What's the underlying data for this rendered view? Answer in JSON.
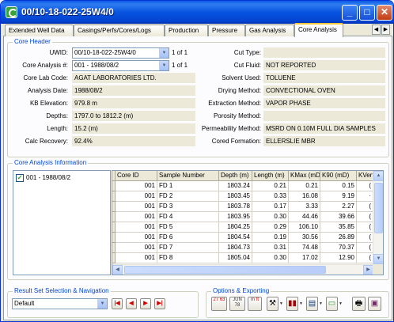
{
  "window": {
    "title": "00/10-18-022-25W4/0",
    "min": "_",
    "max": "□",
    "close": "✕"
  },
  "tabs": [
    {
      "label": "Extended Well Data"
    },
    {
      "label": "Casings/Perfs/Cores/Logs"
    },
    {
      "label": "Production"
    },
    {
      "label": "Pressure"
    },
    {
      "label": "Gas Analysis"
    },
    {
      "label": "Core Analysis",
      "active": true
    }
  ],
  "tab_scroll": {
    "left": "◀",
    "right": "▶"
  },
  "core_header": {
    "legend": "Core Header",
    "uwid_label": "UWID:",
    "uwid_value": "00/10-18-022-25W4/0",
    "uwid_count": "1 of 1",
    "analysis_label": "Core Analysis #:",
    "analysis_value": "001 - 1988/08/2",
    "analysis_count": "1 of 1",
    "lab_label": "Core Lab Code:",
    "lab_value": "AGAT LABORATORIES LTD.",
    "date_label": "Analysis Date:",
    "date_value": "1988/08/2",
    "kb_label": "KB Elevation:",
    "kb_value": "979.8 m",
    "depths_label": "Depths:",
    "depths_value": "1797.0 to 1812.2 (m)",
    "length_label": "Length:",
    "length_value": "15.2 (m)",
    "recovery_label": "Calc Recovery:",
    "recovery_value": "92.4%",
    "cut_type_label": "Cut Type:",
    "cut_type_value": "",
    "cut_fluid_label": "Cut Fluid:",
    "cut_fluid_value": "NOT REPORTED",
    "solvent_label": "Solvent Used:",
    "solvent_value": "TOLUENE",
    "drying_label": "Drying Method:",
    "drying_value": "CONVECTIONAL OVEN",
    "extraction_label": "Extraction Method:",
    "extraction_value": "VAPOR PHASE",
    "porosity_label": "Porosity Method:",
    "porosity_value": "",
    "permeability_label": "Permeability Method:",
    "permeability_value": "MSRD ON 0.10M FULL DIA SAMPLES",
    "formation_label": "Cored Formation:",
    "formation_value": "ELLERSLIE MBR"
  },
  "core_info": {
    "legend": "Core Analysis Information",
    "tree_item": "001 - 1988/08/2",
    "tree_checked": "✓",
    "columns": [
      "Core ID",
      "Sample Number",
      "Depth (m)",
      "Length (m)",
      "KMax (mD",
      "K90 (mD)",
      "KVert"
    ],
    "rows": [
      [
        "001",
        "FD 1",
        "1803.24",
        "0.21",
        "0.21",
        "0.15",
        "("
      ],
      [
        "001",
        "FD 2",
        "1803.45",
        "0.33",
        "16.08",
        "9.19",
        "·"
      ],
      [
        "001",
        "FD 3",
        "1803.78",
        "0.17",
        "3.33",
        "2.27",
        "("
      ],
      [
        "001",
        "FD 4",
        "1803.95",
        "0.30",
        "44.46",
        "39.66",
        "("
      ],
      [
        "001",
        "FD 5",
        "1804.25",
        "0.29",
        "106.10",
        "35.85",
        "("
      ],
      [
        "001",
        "FD 6",
        "1804.54",
        "0.19",
        "30.56",
        "26.89",
        "("
      ],
      [
        "001",
        "FD 7",
        "1804.73",
        "0.31",
        "74.48",
        "70.37",
        "("
      ],
      [
        "001",
        "FD 8",
        "1805.04",
        "0.30",
        "17.02",
        "12.90",
        "("
      ]
    ],
    "scroll": {
      "up": "▲",
      "down": "▼",
      "left": "◀",
      "right": "▶"
    }
  },
  "result_set": {
    "legend": "Result Set Selection & Navigation",
    "selected": "Default",
    "first": "|◀",
    "prev": "◀",
    "next": "▶",
    "last": "▶|"
  },
  "options": {
    "legend": "Options & Exporting",
    "calendar_icon_text": "27 63",
    "jun_icon_text": "JUN 78",
    "m_icon_text": "m ft"
  }
}
